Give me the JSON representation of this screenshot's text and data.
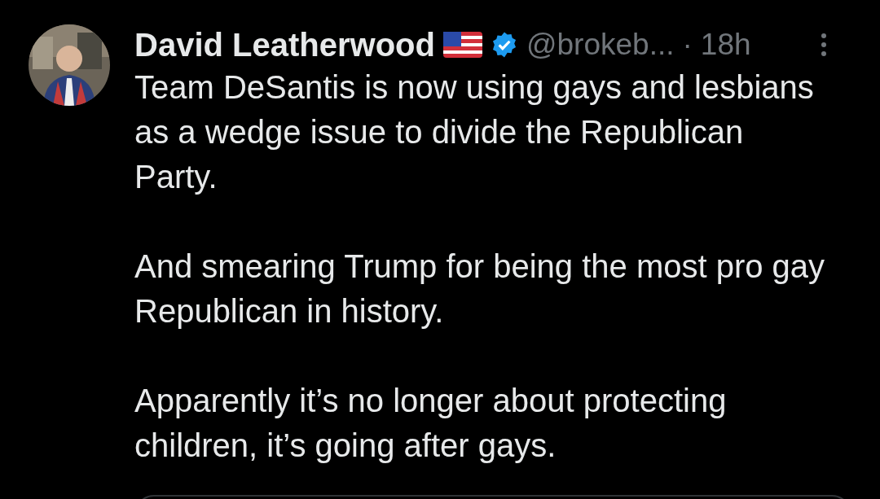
{
  "post": {
    "author": "David Leatherwood",
    "handle": "@brokeb...",
    "separator": "·",
    "time": "18h",
    "verified": true,
    "paragraphs": [
      "Team DeSantis is now using gays and lesbians as a wedge issue to divide the Republican Party.",
      "And smearing Trump for being the most pro gay Republican in history.",
      "Apparently it’s no longer about protecting children, it’s going after gays."
    ]
  }
}
